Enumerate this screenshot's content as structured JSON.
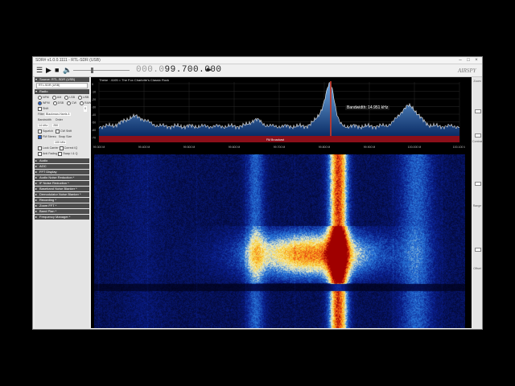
{
  "window": {
    "title": "SDR# v1.0.0.1111 - RTL-SDR (USB)"
  },
  "toolbar": {
    "icons": [
      "menu-icon",
      "play-icon",
      "stop-icon",
      "speaker-icon"
    ],
    "frequency_dim": "000.0",
    "frequency_bright": "99.700.000",
    "arrows": "◂▸",
    "logo": "AIRSPY"
  },
  "left_panel": {
    "source_header": "Source: RTL-SDR (USB)",
    "source_device": "RTL-SDR (USB)",
    "radio_header": "Radio",
    "modes_row1": [
      "NFM",
      "AM",
      "LSB",
      "USB"
    ],
    "modes_row2": [
      "WFM",
      "DSB",
      "CW",
      "RAW"
    ],
    "selected_mode": "WFM",
    "shift_label": "Shift",
    "shift_value": "0",
    "filter_label": "Filter",
    "filter_value": "Blackman-Harris 4",
    "bandwidth_label": "Bandwidth",
    "order_label": "Order",
    "bandwidth_value": "14 kHz",
    "order_value": "250",
    "squelch_label": "Squelch",
    "cw_shift_label": "CW Shift",
    "fm_stereo_label": "FM Stereo",
    "snap_label": "Snap Size",
    "snap_value": "100 kHz",
    "lock_carrier_label": "Lock Carrier",
    "correct_iq_label": "Correct IQ",
    "anti_fading_label": "Anti Fading",
    "swap_iq_label": "Swap I & Q",
    "sections": [
      "Audio",
      "AGC",
      "FFT Display",
      "Audio Noise Reduction *",
      "IF Noise Reduction *",
      "Baseband Noise Blanker *",
      "Demodulator Noise Blanker *",
      "Recording *",
      "Zoom FFT *",
      "Band Plan *",
      "Frequency Manager *"
    ]
  },
  "spectrum": {
    "station": "Theke  ·  4105 = The Fox Charlotte's Classic Rock",
    "bandwidth_text": "Bandwidth: 14.951 kHz",
    "band_label": "FM Broadcast",
    "db_labels": [
      "0",
      "-10",
      "-20",
      "-30",
      "-40",
      "-50",
      "-60",
      "-70"
    ],
    "freq_labels": [
      "99.300 M",
      "99.400 M",
      "99.500 M",
      "99.600 M",
      "99.700 M",
      "99.800 M",
      "99.900 M",
      "100.000 M",
      "100.100 M"
    ]
  },
  "right_panel": {
    "labels": [
      "Zoom",
      "Contrast",
      "Range",
      "Offset"
    ]
  },
  "colors": {
    "accent": "#2b63c9",
    "band": "#8b0f1a",
    "spectrum_fill": "#1f5fa8"
  }
}
